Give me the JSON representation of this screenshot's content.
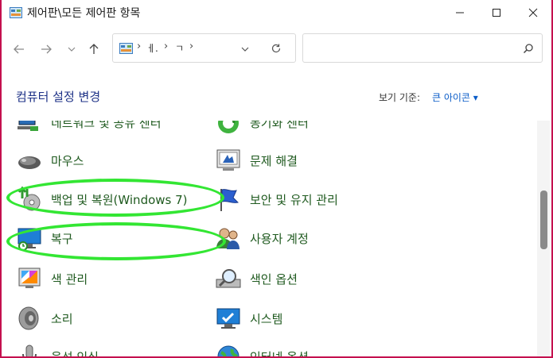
{
  "window": {
    "title": "제어판\\모든 제어판 항목"
  },
  "address": {
    "crumb1": "ㅔ.",
    "crumb2": "ㄱ",
    "search_placeholder": ""
  },
  "header": {
    "title": "컴퓨터 설정 변경",
    "view_by_label": "보기 기준:",
    "view_by_value": "큰 아이콘 ▾"
  },
  "items": [
    {
      "label": "네트워크 및 공유 센터",
      "icon": "network-icon"
    },
    {
      "label": "동기화 센터",
      "icon": "sync-center-icon"
    },
    {
      "label": "마우스",
      "icon": "mouse-icon"
    },
    {
      "label": "문제 해결",
      "icon": "troubleshooting-icon"
    },
    {
      "label": "백업 및 복원(Windows 7)",
      "icon": "backup-restore-icon"
    },
    {
      "label": "보안 및 유지 관리",
      "icon": "security-flag-icon"
    },
    {
      "label": "복구",
      "icon": "recovery-icon"
    },
    {
      "label": "사용자 계정",
      "icon": "user-accounts-icon"
    },
    {
      "label": "색 관리",
      "icon": "color-management-icon"
    },
    {
      "label": "색인 옵션",
      "icon": "indexing-options-icon"
    },
    {
      "label": "소리",
      "icon": "sound-icon"
    },
    {
      "label": "시스템",
      "icon": "system-icon"
    },
    {
      "label": "음성 인식",
      "icon": "speech-recognition-icon"
    },
    {
      "label": "인터넷 옵션",
      "icon": "internet-options-icon"
    }
  ],
  "colors": {
    "titlebar_border": "#c4104e",
    "item_text": "#1f5a1f",
    "heading_text": "#1e3287",
    "annotation": "#33e633"
  }
}
